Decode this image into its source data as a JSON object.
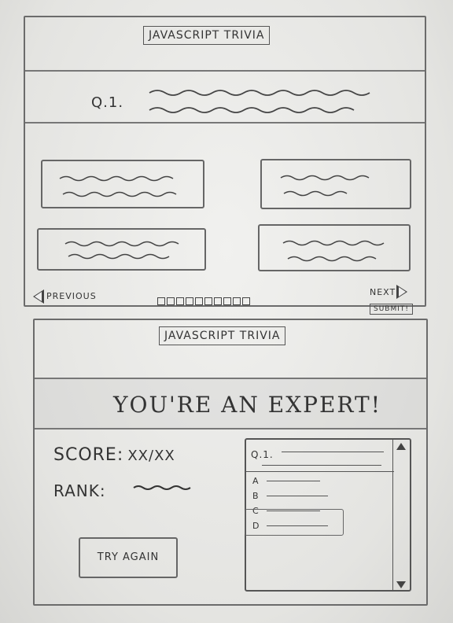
{
  "screen1": {
    "title": "JAVASCRIPT TRIVIA",
    "question_label": "Q.1.",
    "previous_label": "PREVIOUS",
    "next_label": "NEXT",
    "submit_label": "SUBMIT!",
    "page_count": 10
  },
  "screen2": {
    "title": "JAVASCRIPT TRIVIA",
    "result_text": "YOU'RE AN EXPERT!",
    "score_label": "SCORE:",
    "score_value": "XX/XX",
    "rank_label": "RANK:",
    "try_again_label": "TRY AGAIN",
    "review": {
      "question_label": "Q.1.",
      "options": [
        "A",
        "B",
        "C",
        "D"
      ]
    }
  }
}
